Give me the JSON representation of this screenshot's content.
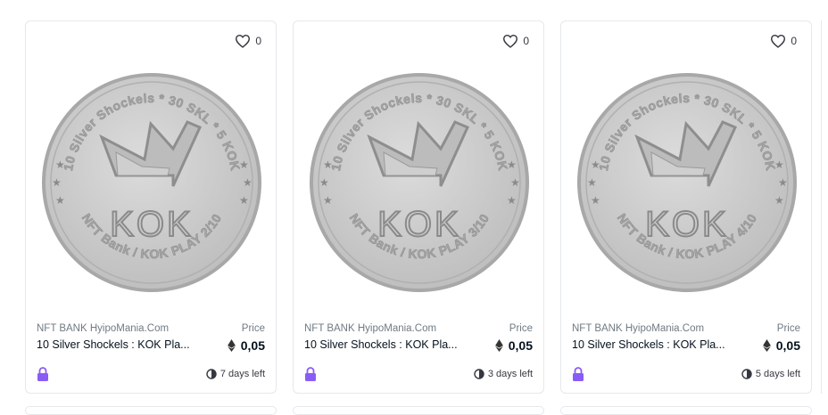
{
  "cards": [
    {
      "favorites": "0",
      "coin_top_text": "10 Silver Shockels * 30 SKL * 5 KOK",
      "coin_bottom_text": "NFT Bank / KOK PLAY 2/10",
      "coin_center_text": "KOK",
      "collection": "NFT BANK HyipoMania.Com",
      "name": "10 Silver Shockels : KOK Pla...",
      "price_label": "Price",
      "price": "0,05",
      "time_left": "7 days left"
    },
    {
      "favorites": "0",
      "coin_top_text": "10 Silver Shockels * 30 SKL * 5 KOK",
      "coin_bottom_text": "NFT Bank / KOK PLAY 3/10",
      "coin_center_text": "KOK",
      "collection": "NFT BANK HyipoMania.Com",
      "name": "10 Silver Shockels : KOK Pla...",
      "price_label": "Price",
      "price": "0,05",
      "time_left": "3 days left"
    },
    {
      "favorites": "0",
      "coin_top_text": "10 Silver Shockels * 30 SKL * 5 KOK",
      "coin_bottom_text": "NFT Bank / KOK PLAY 4/10",
      "coin_center_text": "KOK",
      "collection": "NFT BANK HyipoMania.Com",
      "name": "10 Silver Shockels : KOK Pla...",
      "price_label": "Price",
      "price": "0,05",
      "time_left": "5 days left"
    }
  ],
  "icons": {
    "favorite": "heart-icon",
    "currency": "ethereum-icon",
    "lock": "lock-icon",
    "timer": "clock-icon"
  },
  "colors": {
    "lock_purple": "#8a5cf6",
    "coin_silver": "#c9c9c9",
    "coin_edge": "#9a9a9a"
  }
}
